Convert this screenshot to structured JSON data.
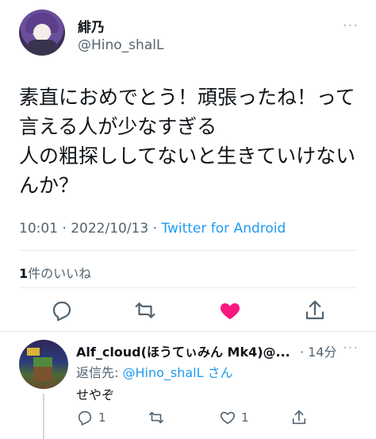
{
  "tweet": {
    "display_name": "緋乃",
    "handle": "@Hino_shalL",
    "text": "素直におめでとう！頑張ったね！って\n言える人が少なすぎる\n人の粗探ししてないと生きていけない\nんか？",
    "time": "10:01 · 2022/10/13 · ",
    "source": "Twitter for Android",
    "likes_count": "1",
    "likes_label": "件のいいね",
    "more": "···"
  },
  "reply": {
    "display_name": "Alf_cloud(ほうてぃみん Mk4)@...",
    "time": "· 14分",
    "replying_prefix": "返信先: ",
    "replying_mention": "@Hino_shalL",
    "replying_suffix": " さん",
    "text": "せやぞ",
    "reply_count": "1",
    "like_count": "1",
    "more": "···"
  },
  "colors": {
    "link": "#1d9bf0",
    "like": "#f91880",
    "secondary_text": "#536471",
    "icon": "#536471"
  },
  "icons": [
    "reply-icon",
    "retweet-icon",
    "heart-icon",
    "share-icon"
  ]
}
